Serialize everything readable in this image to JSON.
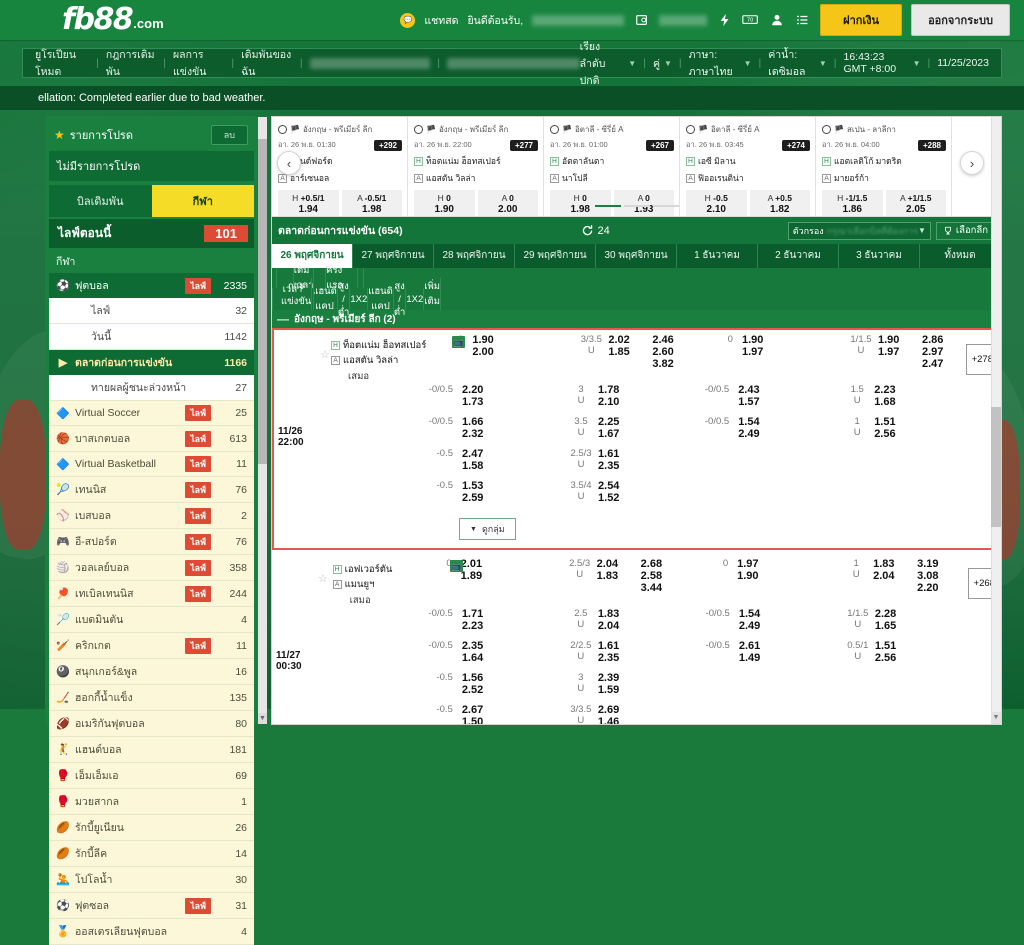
{
  "header": {
    "logo_fb": "fb88",
    "logo_com": ".com",
    "chat_icon": "chat-icon",
    "chat_label": "แชทสด",
    "welcome": "ยินดีต้อนรับ,",
    "deposit_label": "ฝากเงิน",
    "logout_label": "ออกจากระบบ",
    "icons": [
      "wallet-icon",
      "lightning-icon",
      "ticket-icon",
      "user-icon",
      "list-icon"
    ]
  },
  "nav": {
    "links": [
      "ยูโรเปียนโหมด",
      "กฎการเดิมพัน",
      "ผลการแข่งขัน",
      "เดิมพันของฉัน"
    ],
    "right": {
      "sort": "เรียงลำดับปกติ",
      "pair": "คู่",
      "language": "ภาษา: ภาษาไทย",
      "odds": "ค่าน้ำ: เดซิมอล",
      "clock": "16:43:23 GMT +8:00",
      "date": "11/25/2023"
    }
  },
  "notice": "ellation: Completed earlier due to bad weather.",
  "sidebar": {
    "favorites_label": "รายการโปรด",
    "favorites_chip": "ลบ",
    "favorites_empty": "ไม่มีรายการโปรด",
    "tab_bill": "บิลเดิมพัน",
    "tab_sport": "กีฬา",
    "live_now_label": "ไลฟ์ตอนนี้",
    "live_now_count": "101",
    "section_label": "กีฬา",
    "items": [
      {
        "icon": "soccer-ball-icon",
        "name": "ฟุตบอล",
        "live": "ไลฟ์",
        "count": "2335",
        "style": "dark"
      },
      {
        "icon": "",
        "name": "ไลฟ์",
        "live": "",
        "count": "32",
        "style": "light"
      },
      {
        "icon": "",
        "name": "วันนี้",
        "live": "",
        "count": "1142",
        "style": "light"
      },
      {
        "icon": "triangle-icon",
        "name": "ตลาดก่อนการแข่งขัน",
        "live": "",
        "count": "1166",
        "style": "pre"
      },
      {
        "icon": "",
        "name": "ทายผลผู้ชนะล่วงหน้า",
        "live": "",
        "count": "27",
        "style": "light"
      },
      {
        "icon": "virtual-icon",
        "name": "Virtual Soccer",
        "live": "ไลฟ์",
        "count": "25",
        "style": "cream"
      },
      {
        "icon": "basketball-icon",
        "name": "บาสเกตบอล",
        "live": "ไลฟ์",
        "count": "613",
        "style": "cream"
      },
      {
        "icon": "virtual-icon",
        "name": "Virtual Basketball",
        "live": "ไลฟ์",
        "count": "11",
        "style": "cream"
      },
      {
        "icon": "tennis-ball-icon",
        "name": "เทนนิส",
        "live": "ไลฟ์",
        "count": "76",
        "style": "cream"
      },
      {
        "icon": "baseball-icon",
        "name": "เบสบอล",
        "live": "ไลฟ์",
        "count": "2",
        "style": "cream"
      },
      {
        "icon": "gamepad-icon",
        "name": "อี-สปอร์ต",
        "live": "ไลฟ์",
        "count": "76",
        "style": "cream"
      },
      {
        "icon": "volleyball-icon",
        "name": "วอลเลย์บอล",
        "live": "ไลฟ์",
        "count": "358",
        "style": "cream"
      },
      {
        "icon": "pingpong-icon",
        "name": "เทเบิลเทนนิส",
        "live": "ไลฟ์",
        "count": "244",
        "style": "cream"
      },
      {
        "icon": "badminton-icon",
        "name": "แบดมินตัน",
        "live": "",
        "count": "4",
        "style": "cream"
      },
      {
        "icon": "cricket-icon",
        "name": "คริกเกต",
        "live": "ไลฟ์",
        "count": "11",
        "style": "cream"
      },
      {
        "icon": "snooker-icon",
        "name": "สนุกเกอร์&พูล",
        "live": "",
        "count": "16",
        "style": "cream"
      },
      {
        "icon": "hockey-icon",
        "name": "ฮอกกี้น้ำแข็ง",
        "live": "",
        "count": "135",
        "style": "cream"
      },
      {
        "icon": "football-icon",
        "name": "อเมริกันฟุตบอล",
        "live": "",
        "count": "80",
        "style": "cream"
      },
      {
        "icon": "handball-icon",
        "name": "แฮนด์บอล",
        "live": "",
        "count": "181",
        "style": "cream"
      },
      {
        "icon": "mma-icon",
        "name": "เอ็มเอ็มเอ",
        "live": "",
        "count": "69",
        "style": "cream"
      },
      {
        "icon": "boxing-icon",
        "name": "มวยสากล",
        "live": "",
        "count": "1",
        "style": "cream"
      },
      {
        "icon": "rugby-icon",
        "name": "รักบี้ยูเนียน",
        "live": "",
        "count": "26",
        "style": "cream"
      },
      {
        "icon": "rugby-icon",
        "name": "รักบี้ลีค",
        "live": "",
        "count": "14",
        "style": "cream"
      },
      {
        "icon": "waterpolo-icon",
        "name": "โปโลน้ำ",
        "live": "",
        "count": "30",
        "style": "cream"
      },
      {
        "icon": "futsal-icon",
        "name": "ฟุตซอล",
        "live": "ไลฟ์",
        "count": "31",
        "style": "cream"
      },
      {
        "icon": "misc-icon",
        "name": "ออสเตรเลียนฟุตบอล",
        "live": "",
        "count": "4",
        "style": "cream"
      }
    ]
  },
  "carousel": {
    "prev_icon": "chevron-left-icon",
    "next_icon": "chevron-right-icon",
    "cards": [
      {
        "league": "อังกฤษ - พรีเมียร์ ลีก",
        "time": "อา. 26 พ.ย. 01:30",
        "badge": "+292",
        "home": "บรนด์ฟอร์ด",
        "away": "อาร์เซนอล",
        "odds": [
          {
            "lbl": "H",
            "hcp": "+0.5/1",
            "val": "1.94"
          },
          {
            "lbl": "A",
            "hcp": "-0.5/1",
            "val": "1.98"
          }
        ]
      },
      {
        "league": "อังกฤษ - พรีเมียร์ ลีก",
        "time": "อา. 26 พ.ย. 22:00",
        "badge": "+277",
        "home": "ท็อตแน่ม ฮ็อทสเปอร์",
        "away": "แอสตัน วิลล่า",
        "odds": [
          {
            "lbl": "H",
            "hcp": "0",
            "val": "1.90"
          },
          {
            "lbl": "A",
            "hcp": "0",
            "val": "2.00"
          }
        ]
      },
      {
        "league": "อิตาลี - ซีรี่ย์ A",
        "time": "อา. 26 พ.ย. 01:00",
        "badge": "+267",
        "home": "อัตตาลันตา",
        "away": "นาโปลี",
        "odds": [
          {
            "lbl": "H",
            "hcp": "0",
            "val": "1.98"
          },
          {
            "lbl": "A",
            "hcp": "0",
            "val": "1.93"
          }
        ]
      },
      {
        "league": "อิตาลี - ซีรี่ย์ A",
        "time": "อา. 26 พ.ย. 03:45",
        "badge": "+274",
        "home": "เอซี มิลาน",
        "away": "ฟิออเรนติน่า",
        "odds": [
          {
            "lbl": "H",
            "hcp": "-0.5",
            "val": "2.10"
          },
          {
            "lbl": "A",
            "hcp": "+0.5",
            "val": "1.82"
          }
        ]
      },
      {
        "league": "สเปน - ลาลีกา",
        "time": "อา. 26 พ.ย. 04:00",
        "badge": "+288",
        "home": "แอตเลติโก้ มาดริด",
        "away": "มายอร์ก้า",
        "odds": [
          {
            "lbl": "H",
            "hcp": "-1/1.5",
            "val": "1.86"
          },
          {
            "lbl": "A",
            "hcp": "+1/1.5",
            "val": "2.05"
          }
        ]
      }
    ]
  },
  "market_bar": {
    "title": "ตลาดก่อนการแข่งขัน (654)",
    "refresh_icon": "refresh-icon",
    "refresh_count": "24",
    "filter_label": "ตัวกรอง",
    "filter_placeholder": "กรุณาเลือกบิลที่ต้องการ",
    "league_icon": "trophy-icon",
    "league_label": "เลือกลีก"
  },
  "date_tabs": [
    {
      "label": "26 พฤศจิกายน",
      "active": true
    },
    {
      "label": "27 พฤศจิกายน",
      "active": false
    },
    {
      "label": "28 พฤศจิกายน",
      "active": false
    },
    {
      "label": "29 พฤศจิกายน",
      "active": false
    },
    {
      "label": "30 พฤศจิกายน",
      "active": false
    },
    {
      "label": "1 ธันวาคม",
      "active": false
    },
    {
      "label": "2 ธันวาคม",
      "active": false
    },
    {
      "label": "3 ธันวาคม",
      "active": false
    },
    {
      "label": "ทั้งหมด",
      "active": false
    }
  ],
  "table_head": {
    "time": "เวลา",
    "match": "การแข่งขัน",
    "fulltime": "เต็มเวลา",
    "firsthalf": "ครึ่งแรก",
    "handicap": "แฮนดิแคป",
    "overunder": "สูง / ต่ำ",
    "x12": "1X2",
    "more": "เพิ่มเติม"
  },
  "league_group": {
    "collapse_icon": "minus-icon",
    "name": "อังกฤษ - พรีเมียร์ ลีก (2)"
  },
  "matches": [
    {
      "highlight": true,
      "date": "11/26",
      "time": "22:00",
      "home": "ท็อตแน่ม ฮ็อทสเปอร์",
      "away": "แอสตัน วิลล่า",
      "draw": "เสมอ",
      "tv_icon": "tv-icon",
      "star_icon": "star-icon",
      "more_badge": "+278",
      "group_button": "ดูกลุ่ม",
      "lines": [
        {
          "ft_hcp": "0",
          "ft_h": "1.90",
          "ft_a": "2.00",
          "ou_line": "3/3.5",
          "ou_o": "2.02",
          "ou_u": "1.85",
          "x2": [
            "2.46",
            "2.60",
            "3.82"
          ],
          "ht_hcp": "0",
          "ht_h": "1.90",
          "ht_a": "1.97",
          "htou_line": "1/1.5",
          "htou_o": "1.90",
          "htou_u": "1.97",
          "htx2": [
            "2.86",
            "2.97",
            "2.47"
          ]
        },
        {
          "ft_hcp": "-0/0.5",
          "ft_h": "2.20",
          "ft_a": "1.73",
          "ou_line": "3",
          "ou_o": "1.78",
          "ou_u": "2.10",
          "x2": [],
          "ht_hcp": "-0/0.5",
          "ht_h": "2.43",
          "ht_a": "1.57",
          "htou_line": "1.5",
          "htou_o": "2.23",
          "htou_u": "1.68",
          "htx2": []
        },
        {
          "ft_hcp": "-0/0.5",
          "ft_h": "1.66",
          "ft_a": "2.32",
          "ou_line": "3.5",
          "ou_o": "2.25",
          "ou_u": "1.67",
          "x2": [],
          "ht_hcp": "-0/0.5",
          "ht_h": "1.54",
          "ht_a": "2.49",
          "htou_line": "1",
          "htou_o": "1.51",
          "htou_u": "2.56",
          "htx2": []
        },
        {
          "ft_hcp": "-0.5",
          "ft_h": "2.47",
          "ft_a": "1.58",
          "ou_line": "2.5/3",
          "ou_o": "1.61",
          "ou_u": "2.35",
          "x2": [],
          "ht_hcp": "",
          "ht_h": "",
          "ht_a": "",
          "htou_line": "",
          "htou_o": "",
          "htou_u": "",
          "htx2": []
        },
        {
          "ft_hcp": "-0.5",
          "ft_h": "1.53",
          "ft_a": "2.59",
          "ou_line": "3.5/4",
          "ou_o": "2.54",
          "ou_u": "1.52",
          "x2": [],
          "ht_hcp": "",
          "ht_h": "",
          "ht_a": "",
          "htou_line": "",
          "htou_o": "",
          "htou_u": "",
          "htx2": []
        }
      ]
    },
    {
      "highlight": false,
      "date": "11/27",
      "time": "00:30",
      "home": "เอฟเวอร์ตัน",
      "away": "แมนยูฯ",
      "draw": "เสมอ",
      "tv_icon": "tv-icon",
      "star_icon": "star-icon",
      "more_badge": "+268",
      "group_button": "ดูกลุ่ม",
      "lines": [
        {
          "ft_hcp": "0",
          "ft_h": "2.01",
          "ft_a": "1.89",
          "ou_line": "2.5/3",
          "ou_o": "2.04",
          "ou_u": "1.83",
          "x2": [
            "2.68",
            "2.58",
            "3.44"
          ],
          "ht_hcp": "0",
          "ht_h": "1.97",
          "ht_a": "1.90",
          "htou_line": "1",
          "htou_o": "1.83",
          "htou_u": "2.04",
          "htx2": [
            "3.19",
            "3.08",
            "2.20"
          ]
        },
        {
          "ft_hcp": "-0/0.5",
          "ft_h": "1.71",
          "ft_a": "2.23",
          "ou_line": "2.5",
          "ou_o": "1.83",
          "ou_u": "2.04",
          "x2": [],
          "ht_hcp": "-0/0.5",
          "ht_h": "1.54",
          "ht_a": "2.49",
          "htou_line": "1/1.5",
          "htou_o": "2.28",
          "htou_u": "1.65",
          "htx2": []
        },
        {
          "ft_hcp": "-0/0.5",
          "ft_h": "2.35",
          "ft_a": "1.64",
          "ou_line": "2/2.5",
          "ou_o": "1.61",
          "ou_u": "2.35",
          "x2": [],
          "ht_hcp": "-0/0.5",
          "ht_h": "2.61",
          "ht_a": "1.49",
          "htou_line": "0.5/1",
          "htou_o": "1.51",
          "htou_u": "2.56",
          "htx2": []
        },
        {
          "ft_hcp": "-0.5",
          "ft_h": "1.56",
          "ft_a": "2.52",
          "ou_line": "3",
          "ou_o": "2.39",
          "ou_u": "1.59",
          "x2": [],
          "ht_hcp": "",
          "ht_h": "",
          "ht_a": "",
          "htou_line": "",
          "htou_o": "",
          "htou_u": "",
          "htx2": []
        },
        {
          "ft_hcp": "-0.5",
          "ft_h": "2.67",
          "ft_a": "1.50",
          "ou_line": "3/3.5",
          "ou_o": "2.69",
          "ou_u": "1.46",
          "x2": [],
          "ht_hcp": "",
          "ht_h": "",
          "ht_a": "",
          "htou_line": "",
          "htou_o": "",
          "htou_u": "",
          "htx2": []
        }
      ]
    }
  ],
  "colors": {
    "brand_green": "#1a8040",
    "dark_green": "#0d6b33",
    "accent_yellow": "#f5c518",
    "live_red": "#de4b35",
    "highlight_red": "#e6574f"
  }
}
